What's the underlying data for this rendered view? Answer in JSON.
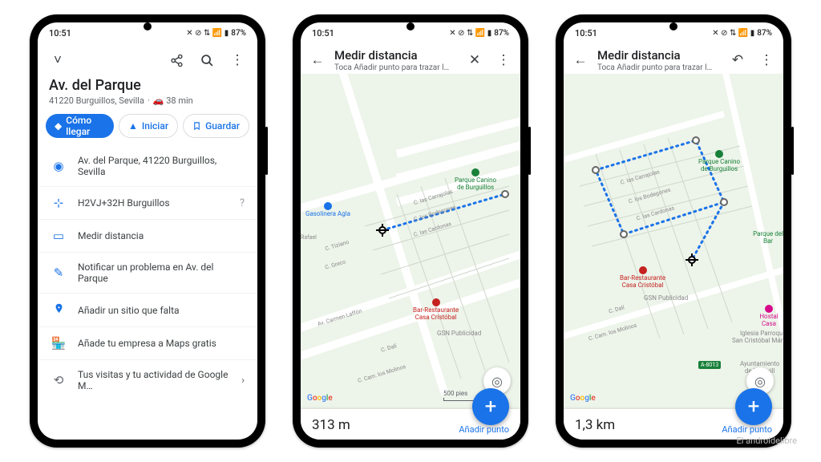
{
  "status": {
    "time": "10:51",
    "battery": "87%",
    "icons": "✕ ⊘ ⇅ 📶 ▮"
  },
  "phone1": {
    "place_title": "Av. del Parque",
    "place_sub_prefix": "41220 Burguillos, Sevilla",
    "place_sub_eta": "38 min",
    "chips": {
      "directions": "Cómo llegar",
      "start": "Iniciar",
      "save": "Guardar"
    },
    "rows": {
      "address": "Av. del Parque, 41220 Burguillos, Sevilla",
      "pluscode": "H2VJ+32H Burguillos",
      "measure": "Medir distancia",
      "report": "Notificar un problema en Av. del Parque",
      "missing": "Añadir un sitio que falta",
      "business": "Añade tu empresa a Maps gratis",
      "activity": "Tus visitas y tu actividad de Google M…"
    }
  },
  "phone2": {
    "title": "Medir distancia",
    "subtitle": "Toca Añadir punto para trazar l…",
    "distance": "313 m",
    "add_point": "Añadir punto",
    "scale": "500 pies",
    "pois": {
      "gasolinera": "Gasolinera Agla",
      "parque": "Parque Canino\nde Burguillos",
      "bar": "Bar-Restaurante\nCasa Cristóbal",
      "gsn": "GSN Publicidad"
    },
    "roads": {
      "carrajolas": "C. las Carrajolas",
      "bodegones": "C. los Bodegones",
      "cardonas": "C. las Cardonas",
      "tiziano": "C. Tiziano",
      "greco": "C. Greco",
      "rafael": "Rafael",
      "carmen": "Av. Carmen Laffón",
      "molinos": "C. Cam. los Molinos",
      "dali": "C. Dalí"
    }
  },
  "phone3": {
    "title": "Medir distancia",
    "subtitle": "Toca Añadir punto para trazar l…",
    "distance": "1,3 km",
    "add_point": "Añadir punto",
    "pois": {
      "parque": "Parque Canino\nde Burguillos",
      "parquebar": "Parque del Bar",
      "bar": "Bar-Restaurante\nCasa Cristóbal",
      "gsn": "GSN Publicidad",
      "hostal": "Hostal Casa",
      "iglesia": "Iglesia Parroquial\nSan Cristóbal Mártir de",
      "ayto": "Ayuntamiento\nde Burguill",
      "a8013": "A-8013"
    },
    "roads": {
      "carrajolas": "C. las Carrajolas",
      "bodegones": "C. los Bodegones",
      "cardonas": "C. las Cardonas",
      "molinos": "C. Cam. los Molinos",
      "dali": "C. Dalí"
    }
  },
  "google": "Google",
  "watermark": "El androidelibre"
}
